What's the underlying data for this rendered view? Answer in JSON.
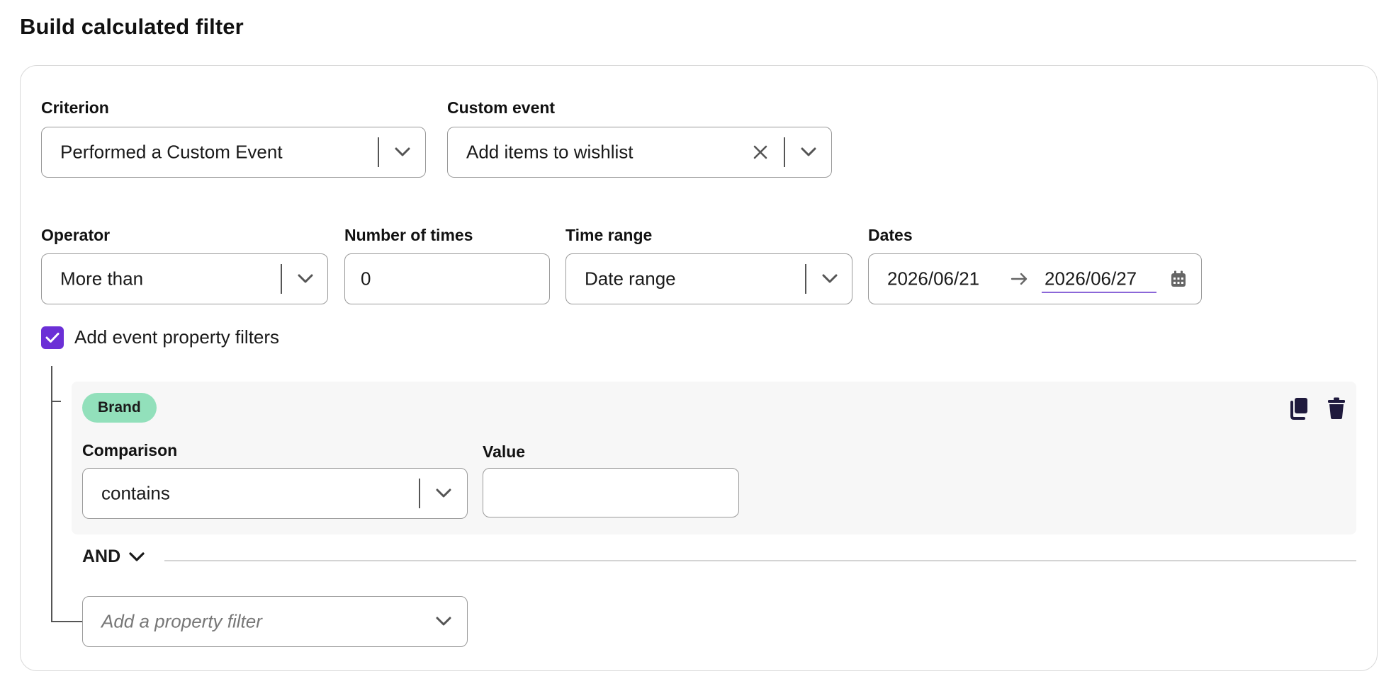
{
  "page": {
    "title": "Build calculated filter"
  },
  "criterion": {
    "label": "Criterion",
    "value": "Performed a Custom Event"
  },
  "custom_event": {
    "label": "Custom event",
    "value": "Add items to wishlist"
  },
  "operator": {
    "label": "Operator",
    "value": "More than"
  },
  "number_of_times": {
    "label": "Number of times",
    "value": "0"
  },
  "time_range": {
    "label": "Time range",
    "value": "Date range"
  },
  "dates": {
    "label": "Dates",
    "start": "2026/06/21",
    "end": "2026/06/27"
  },
  "event_property_filters": {
    "checkbox_label": "Add event property filters",
    "checked": true,
    "filter": {
      "property_badge": "Brand",
      "comparison": {
        "label": "Comparison",
        "value": "contains"
      },
      "value": {
        "label": "Value",
        "value": ""
      }
    },
    "logic_operator": "AND",
    "add_filter": {
      "placeholder": "Add a property filter"
    }
  },
  "colors": {
    "accent": "#6b2fd6",
    "badge": "#92e0bb",
    "icon_dark": "#1f1a3d"
  }
}
